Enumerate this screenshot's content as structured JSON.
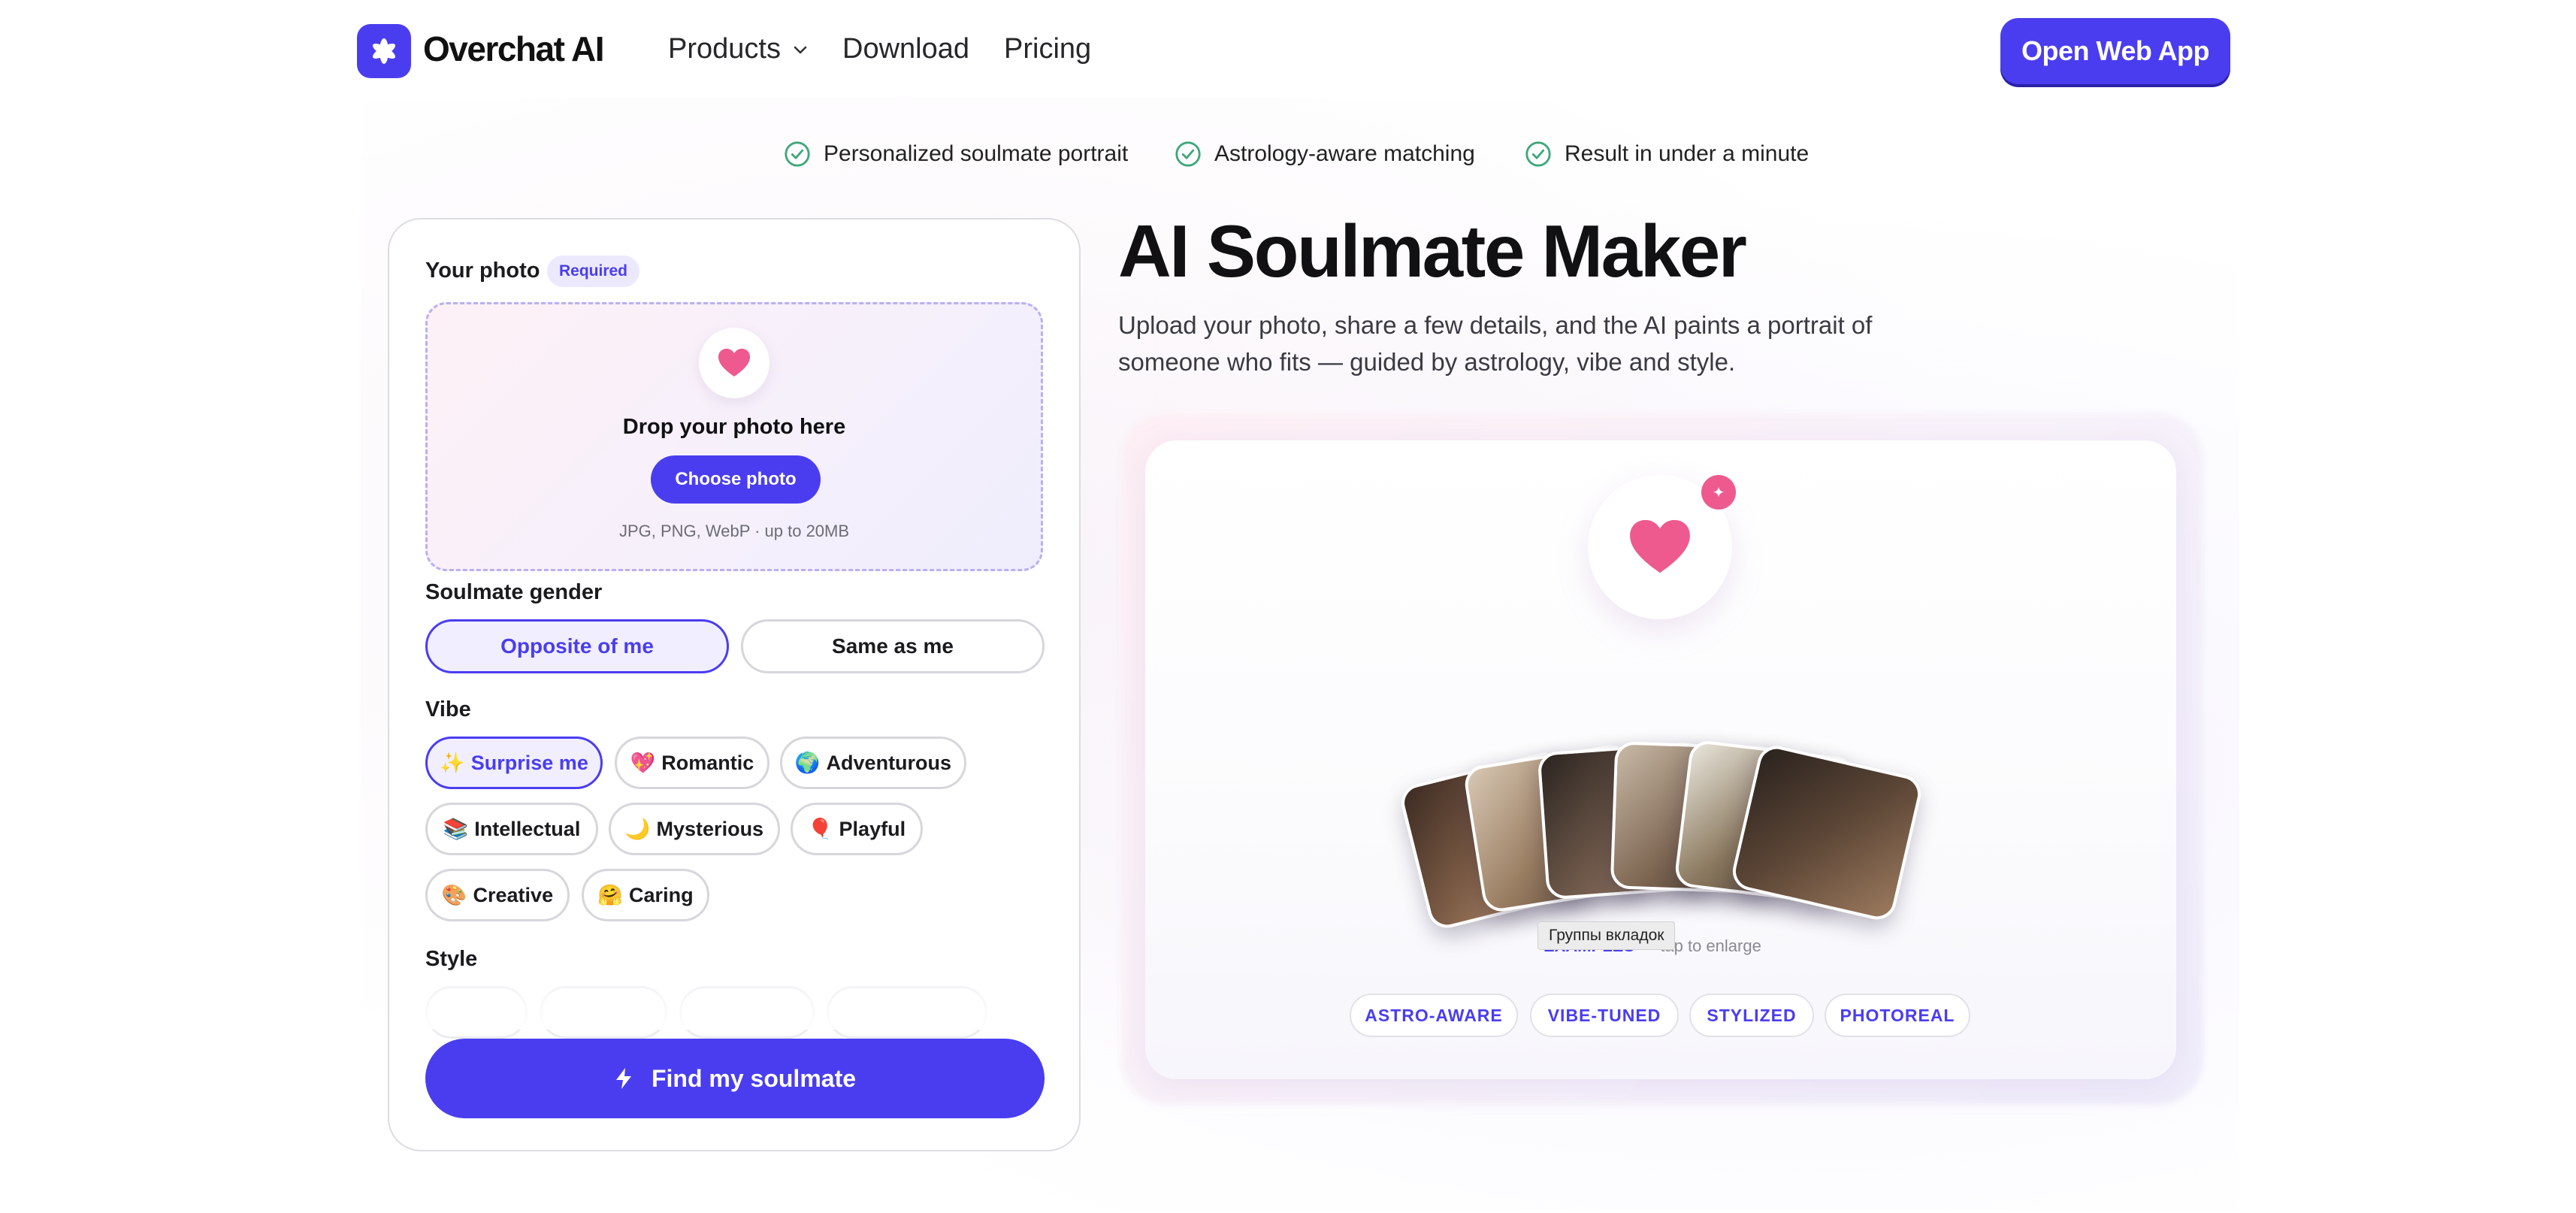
{
  "nav": {
    "brand": "Overchat AI",
    "products": "Products",
    "download": "Download",
    "pricing": "Pricing",
    "open_app": "Open Web App"
  },
  "features": [
    "Personalized soulmate portrait",
    "Astrology-aware matching",
    "Result in under a minute"
  ],
  "form": {
    "photo_label": "Your photo",
    "required_badge": "Required",
    "drop_title": "Drop your photo here",
    "choose_button": "Choose photo",
    "drop_hint": "JPG, PNG, WebP · up to 20MB",
    "gender_label": "Soulmate gender",
    "gender_options": [
      "Opposite of me",
      "Same as me"
    ],
    "gender_selected": "Opposite of me",
    "vibe_label": "Vibe",
    "vibes": [
      {
        "emoji": "✨",
        "label": "Surprise me",
        "selected": true
      },
      {
        "emoji": "💖",
        "label": "Romantic",
        "selected": false
      },
      {
        "emoji": "🌍",
        "label": "Adventurous",
        "selected": false
      },
      {
        "emoji": "📚",
        "label": "Intellectual",
        "selected": false
      },
      {
        "emoji": "🌙",
        "label": "Mysterious",
        "selected": false
      },
      {
        "emoji": "🎈",
        "label": "Playful",
        "selected": false
      },
      {
        "emoji": "🎨",
        "label": "Creative",
        "selected": false
      },
      {
        "emoji": "🤗",
        "label": "Caring",
        "selected": false
      }
    ],
    "style_label": "Style",
    "submit": "Find my soulmate"
  },
  "hero": {
    "title": "AI Soulmate Maker",
    "lead": "Upload your photo, share a few details, and the AI paints a portrait of someone who fits — guided by astrology, vibe and style."
  },
  "showcase": {
    "examples_label": "EXAMPLES",
    "examples_hint": "— tap to enlarge",
    "tooltip": "Группы вкладок",
    "tags": [
      "ASTRO-AWARE",
      "VIBE-TUNED",
      "STYLIZED",
      "PHOTOREAL"
    ]
  },
  "colors": {
    "accent": "#4a3df0",
    "accent_soft": "#f1efff",
    "heart": "#ee5a8e",
    "check": "#3fa77a"
  }
}
